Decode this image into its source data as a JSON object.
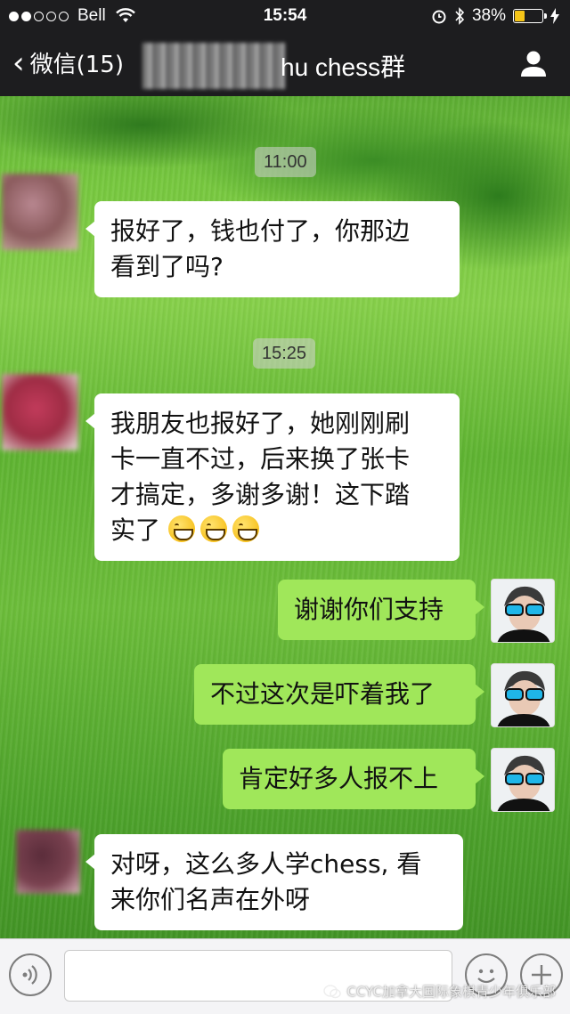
{
  "status_bar": {
    "carrier": "Bell",
    "time": "15:54",
    "battery_percent": "38%",
    "battery_level": 0.38,
    "battery_color": "#f5c518"
  },
  "nav": {
    "back_label": "微信(15)",
    "title_visible": "hu chess群",
    "right_icon": "person-icon"
  },
  "messages": [
    {
      "type": "timestamp",
      "text": "11:00"
    },
    {
      "type": "incoming",
      "lines": [
        "报好了，钱也付了，你那边",
        "看到了吗?"
      ]
    },
    {
      "type": "timestamp",
      "text": "15:25"
    },
    {
      "type": "incoming",
      "lines": [
        "我朋友也报好了，她刚刚刷",
        "卡一直不过，后来换了张卡",
        "才搞定，多谢多谢！这下踏",
        "实了"
      ],
      "emoji_count": 3,
      "emoji_name": "grinning-face"
    },
    {
      "type": "outgoing",
      "lines": [
        "谢谢你们支持"
      ]
    },
    {
      "type": "outgoing",
      "lines": [
        "不过这次是吓着我了"
      ]
    },
    {
      "type": "outgoing",
      "lines": [
        "肯定好多人报不上"
      ]
    },
    {
      "type": "incoming",
      "lines": [
        "对呀，这么多人学chess, 看",
        "来你们名声在外呀"
      ]
    }
  ],
  "input_bar": {
    "watermark": "CCYC加拿大国际象棋青少年俱乐部",
    "left_icon": "voice-icon",
    "emoji_icon": "smiley-icon",
    "plus_icon": "plus-icon"
  },
  "colors": {
    "outgoing_bubble": "#a0e75a",
    "incoming_bubble": "#ffffff",
    "nav_background": "#1d1d1f"
  }
}
